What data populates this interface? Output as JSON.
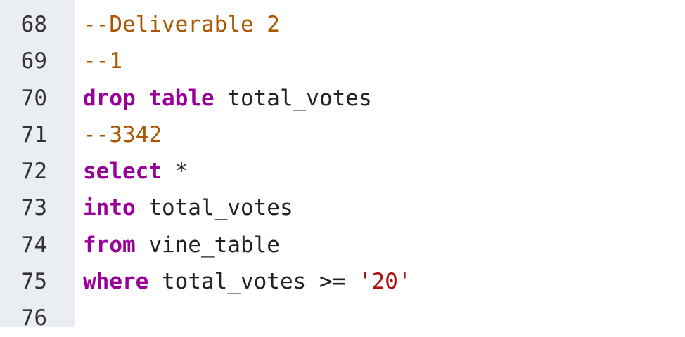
{
  "colors": {
    "keyword": "#990099",
    "comment": "#aa5500",
    "string": "#aa1111",
    "gutter": "#eaedf2"
  },
  "lines": [
    {
      "num": "68",
      "tokens": [
        {
          "t": "cm",
          "v": "--Deliverable 2"
        }
      ]
    },
    {
      "num": "69",
      "tokens": [
        {
          "t": "cm",
          "v": "--1"
        }
      ]
    },
    {
      "num": "70",
      "tokens": [
        {
          "t": "kw",
          "v": "drop"
        },
        {
          "t": "tx",
          "v": " "
        },
        {
          "t": "kw",
          "v": "table"
        },
        {
          "t": "tx",
          "v": " total_votes"
        }
      ]
    },
    {
      "num": "71",
      "tokens": [
        {
          "t": "cm",
          "v": "--3342"
        }
      ]
    },
    {
      "num": "72",
      "tokens": [
        {
          "t": "kw",
          "v": "select"
        },
        {
          "t": "tx",
          "v": " *"
        }
      ]
    },
    {
      "num": "73",
      "tokens": [
        {
          "t": "kw",
          "v": "into"
        },
        {
          "t": "tx",
          "v": " total_votes"
        }
      ]
    },
    {
      "num": "74",
      "tokens": [
        {
          "t": "kw",
          "v": "from"
        },
        {
          "t": "tx",
          "v": " vine_table"
        }
      ]
    },
    {
      "num": "75",
      "tokens": [
        {
          "t": "kw",
          "v": "where"
        },
        {
          "t": "tx",
          "v": " total_votes >= "
        },
        {
          "t": "str",
          "v": "'20'"
        }
      ]
    },
    {
      "num": "76",
      "tokens": []
    }
  ]
}
